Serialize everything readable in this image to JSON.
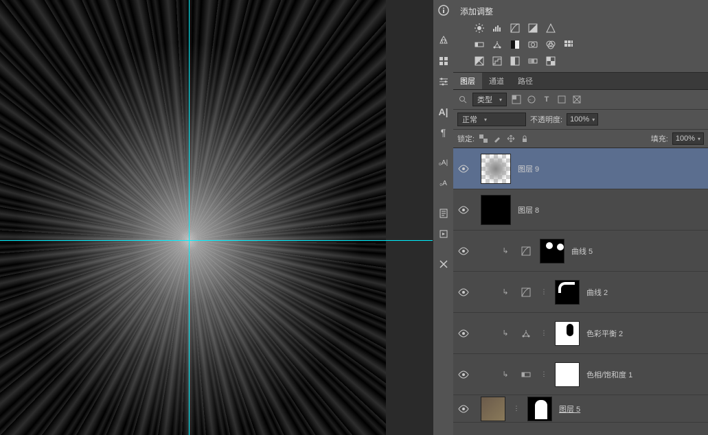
{
  "adjustments_panel": {
    "title": "添加调整"
  },
  "panels_tabs": {
    "layers": "图层",
    "channels": "通道",
    "paths": "路径"
  },
  "layers_panel": {
    "filter_label": "类型",
    "blend_mode": "正常",
    "opacity_label": "不透明度:",
    "opacity_value": "100%",
    "lock_label": "锁定:",
    "fill_label": "填充:",
    "fill_value": "100%"
  },
  "layers": [
    {
      "name": "图层 9"
    },
    {
      "name": "图层 8"
    },
    {
      "name": "曲线 5"
    },
    {
      "name": "曲线 2"
    },
    {
      "name": "色彩平衡 2"
    },
    {
      "name": "色相/饱和度 1"
    },
    {
      "name": "图层 5"
    }
  ]
}
